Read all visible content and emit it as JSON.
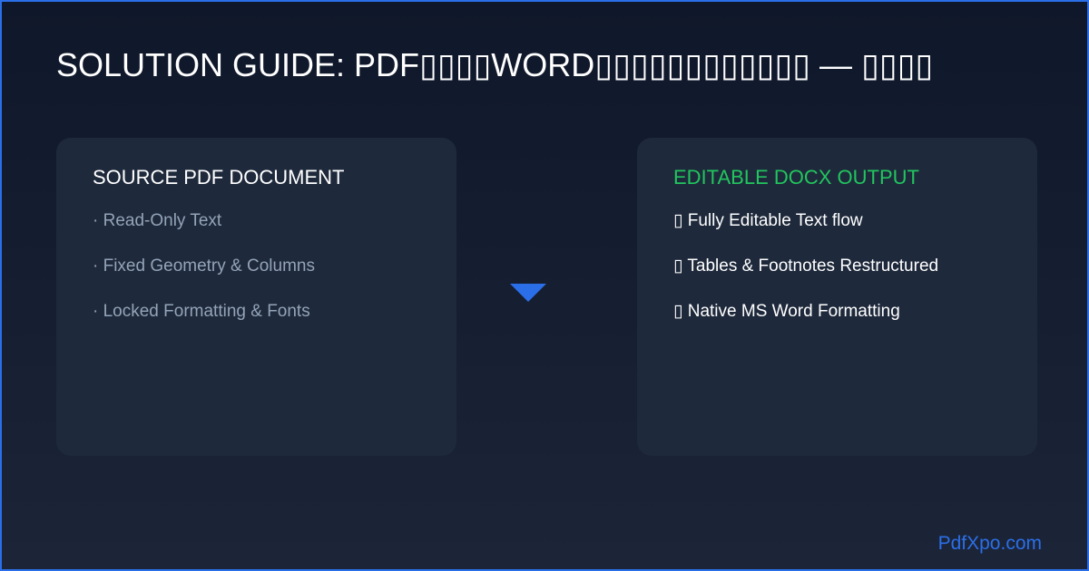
{
  "title": "SOLUTION GUIDE: PDF▯▯▯▯WORD▯▯▯▯▯▯▯▯▯▯▯▯ — ▯▯▯▯",
  "source_card": {
    "heading": "SOURCE PDF DOCUMENT",
    "items": [
      "· Read-Only Text",
      "· Fixed Geometry & Columns",
      "· Locked Formatting & Fonts"
    ]
  },
  "output_card": {
    "heading": "EDITABLE DOCX OUTPUT",
    "items": [
      "▯ Fully Editable Text flow",
      "▯ Tables & Footnotes Restructured",
      "▯ Native MS Word Formatting"
    ]
  },
  "arrow_icon": "down-arrow-icon",
  "footer": {
    "site": "PdfXpo.com"
  },
  "colors": {
    "background": "#0f172a",
    "card": "#1e293b",
    "accent_blue": "#2b6fe8",
    "accent_green": "#22c55e",
    "muted_text": "#94a3b8"
  }
}
